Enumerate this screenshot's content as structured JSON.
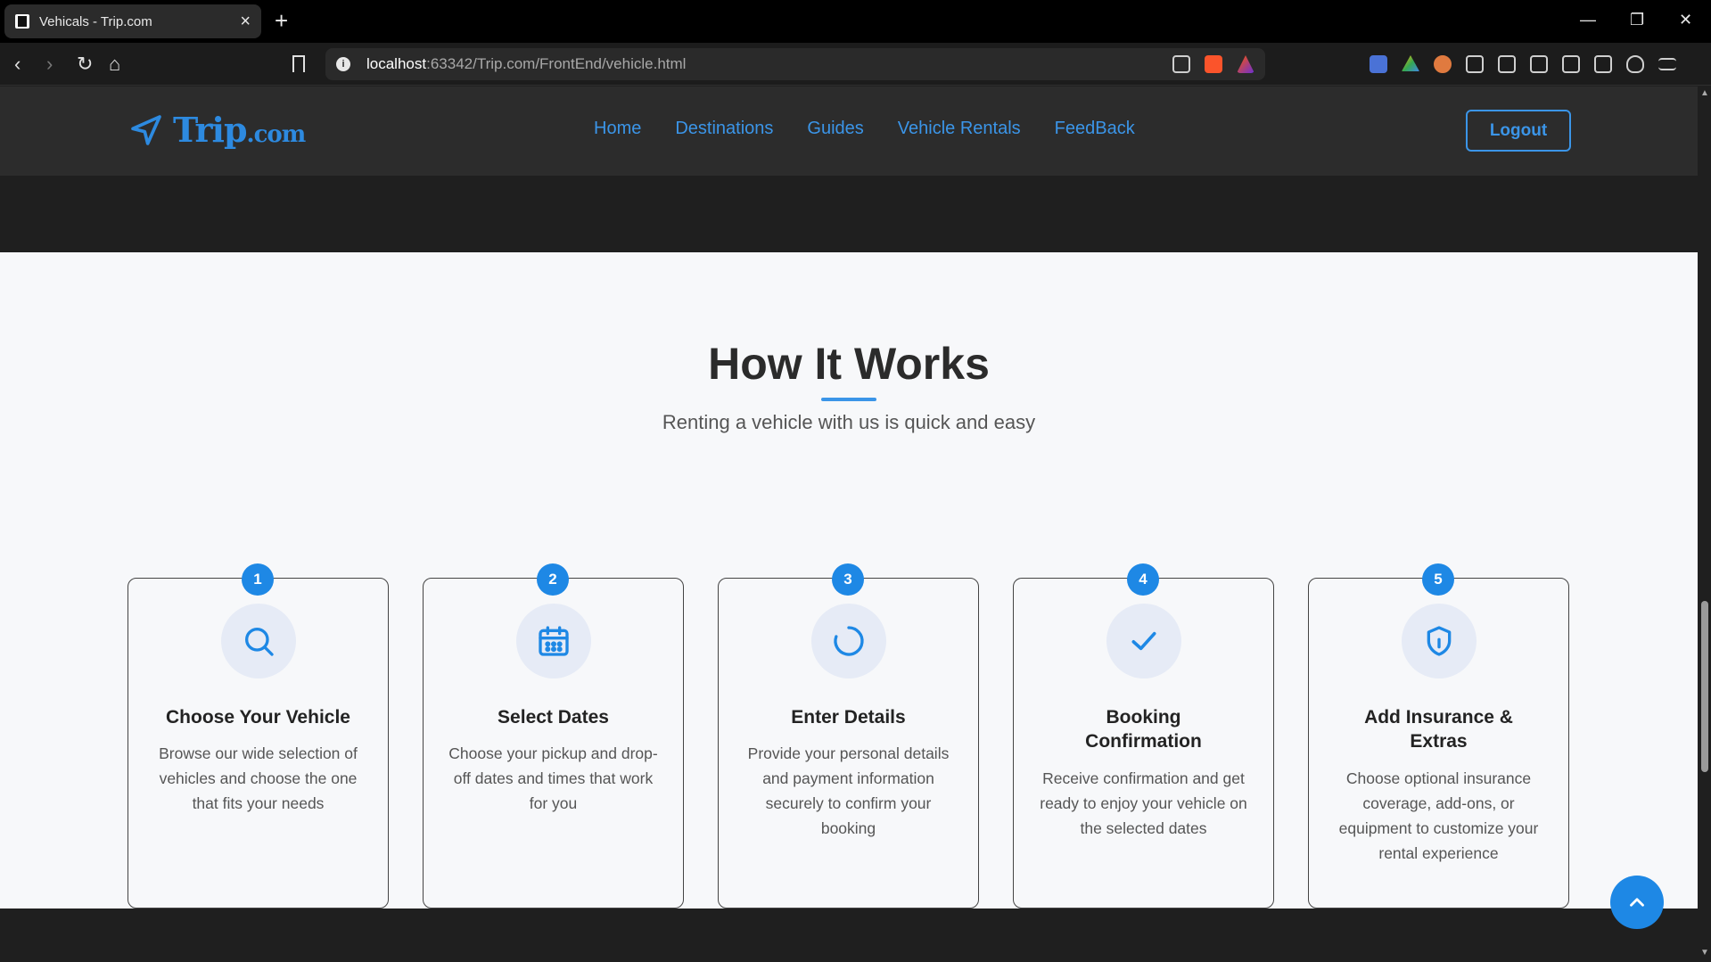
{
  "browser": {
    "tab_title": "Vehicals - Trip.com",
    "url_host": "localhost",
    "url_rest": ":63342/Trip.com/FrontEnd/vehicle.html"
  },
  "site": {
    "logo_main": "Trip",
    "logo_suffix": ".com",
    "nav": [
      "Home",
      "Destinations",
      "Guides",
      "Vehicle Rentals",
      "FeedBack"
    ],
    "logout_label": "Logout",
    "accent_color": "#1e88e5"
  },
  "section": {
    "title": "How It Works",
    "subtitle": "Renting a vehicle with us is quick and easy",
    "steps": [
      {
        "number": "1",
        "icon": "search-icon",
        "title": "Choose Your Vehicle",
        "text": "Browse our wide selection of vehicles and choose the one that fits your needs"
      },
      {
        "number": "2",
        "icon": "calendar-icon",
        "title": "Select Dates",
        "text": "Choose your pickup and drop-off dates and times that work for you"
      },
      {
        "number": "3",
        "icon": "spinner-icon",
        "title": "Enter Details",
        "text": "Provide your personal details and payment information securely to confirm your booking"
      },
      {
        "number": "4",
        "icon": "check-icon",
        "title": "Booking Confirmation",
        "text": "Receive confirmation and get ready to enjoy your vehicle on the selected dates"
      },
      {
        "number": "5",
        "icon": "shield-icon",
        "title": "Add Insurance & Extras",
        "text": "Choose optional insurance coverage, add-ons, or equipment to customize your rental experience"
      }
    ]
  }
}
